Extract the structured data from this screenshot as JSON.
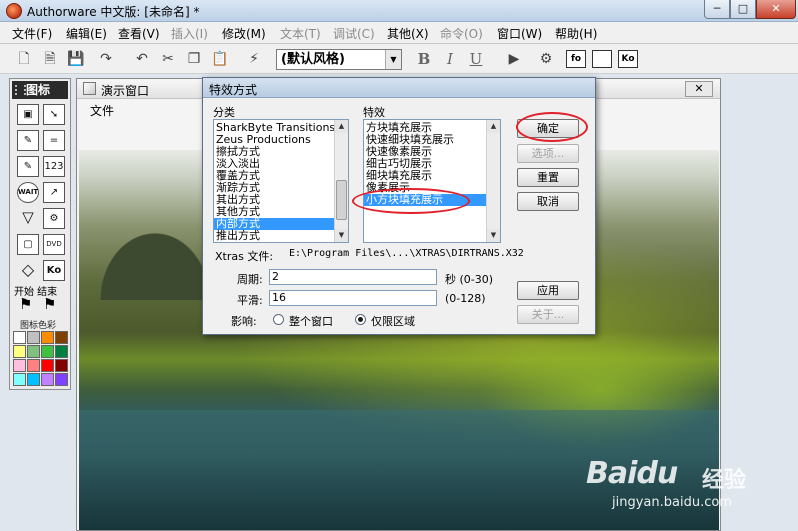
{
  "app": {
    "title": "Authorware 中文版: [未命名] *",
    "window_controls": {
      "minimize": "─",
      "maximize": "□",
      "close": "✕"
    }
  },
  "menubar": {
    "items": [
      {
        "label": "文件(F)",
        "enabled": true
      },
      {
        "label": "编辑(E)",
        "enabled": true
      },
      {
        "label": "查看(V)",
        "enabled": true
      },
      {
        "label": "插入(I)",
        "enabled": false
      },
      {
        "label": "修改(M)",
        "enabled": true
      },
      {
        "label": "文本(T)",
        "enabled": false
      },
      {
        "label": "调试(C)",
        "enabled": false
      },
      {
        "label": "其他(X)",
        "enabled": true
      },
      {
        "label": "命令(O)",
        "enabled": false
      },
      {
        "label": "窗口(W)",
        "enabled": true
      },
      {
        "label": "帮助(H)",
        "enabled": true
      }
    ]
  },
  "toolbar": {
    "style_combo_value": "(默认风格)",
    "bold": "B",
    "italic": "I",
    "underline": "U",
    "box_icons": [
      "fo",
      "",
      "Ko"
    ]
  },
  "palette": {
    "title": "图标",
    "icon_labels": [
      "",
      "",
      "",
      "",
      "=",
      "",
      "",
      "123",
      "WAIT",
      "",
      "",
      "",
      "",
      "DVD",
      "",
      "Ko"
    ],
    "start_end": "开始 结束",
    "color_label": "图标色彩",
    "colors": [
      "#ffffff",
      "#c0c0c0",
      "#ff8c00",
      "#804000",
      "#ffff80",
      "#80c080",
      "#40c040",
      "#008040",
      "#ffc0e0",
      "#ff8080",
      "#ff0000",
      "#800000",
      "#80ffff",
      "#00c0ff",
      "#c080ff",
      "#8040ff"
    ]
  },
  "presentation": {
    "title": "演示窗口",
    "close": "✕",
    "menu_file": "文件"
  },
  "dialog": {
    "title": "特效方式",
    "category_label": "分类",
    "categories": [
      "SharkByte Transitions",
      "Zeus Productions",
      "擦拭方式",
      "淡入淡出",
      "覆盖方式",
      "渐踪方式",
      "其出方式",
      "其他方式",
      "内部方式",
      "推出方式"
    ],
    "category_selected_index": 8,
    "effect_label": "特效",
    "effects": [
      "方块填充展示",
      "快速细块填充展示",
      "快速像素展示",
      "细古巧切展示",
      "细块填充展示",
      "像素展示",
      "小方块填充展示"
    ],
    "effect_selected_index": 6,
    "xtras_label": "Xtras 文件:",
    "xtras_path": "E:\\Program Files\\...\\XTRAS\\DIRTRANS.X32",
    "period_label": "周期:",
    "period_value": "2",
    "period_unit": "秒 (0-30)",
    "smooth_label": "平滑:",
    "smooth_value": "16",
    "smooth_range": "(0-128)",
    "affect_label": "影响:",
    "affect_options": [
      "整个窗口",
      "仅限区域"
    ],
    "affect_selected_index": 1,
    "buttons": {
      "ok": "确定",
      "options": "选项...",
      "reset": "重置",
      "cancel": "取消",
      "apply": "应用",
      "about": "关于..."
    }
  },
  "watermark": {
    "brand": "Baidu",
    "brand_cn": "经验",
    "url": "jingyan.baidu.com"
  },
  "colors": {
    "selection": "#3399ff",
    "annotation_red": "#e0202a"
  }
}
